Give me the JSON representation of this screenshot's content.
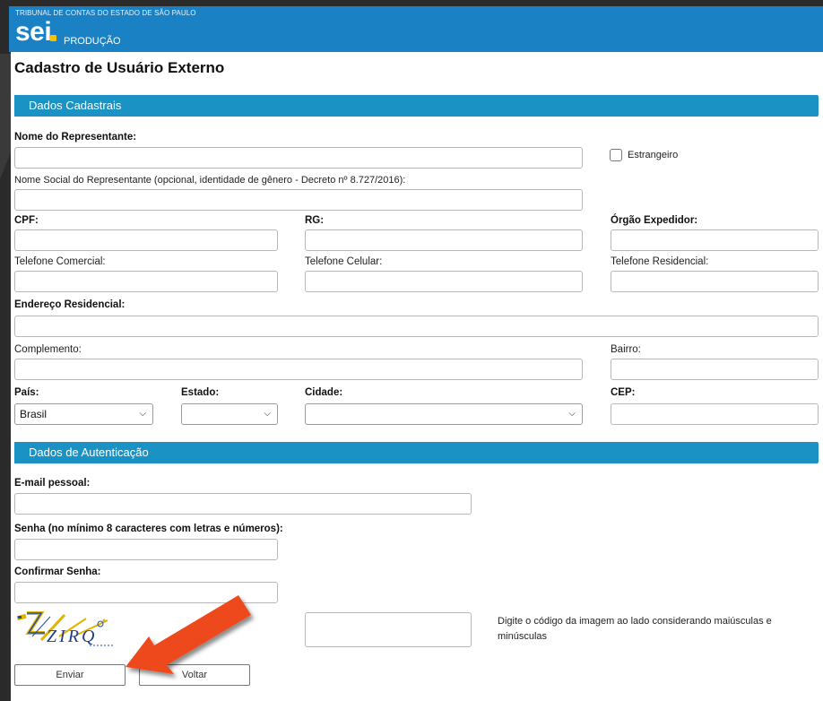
{
  "header": {
    "org": "TRIBUNAL DE CONTAS DO ESTADO DE SÃO PAULO",
    "logo": "sei",
    "environment": "PRODUÇÃO"
  },
  "page_title": "Cadastro de Usuário Externo",
  "sections": {
    "cadastrais": "Dados Cadastrais",
    "autenticacao": "Dados de Autenticação"
  },
  "fields": {
    "nome_representante": "Nome do Representante:",
    "estrangeiro": "Estrangeiro",
    "nome_social": "Nome Social do Representante (opcional, identidade de gênero - Decreto nº 8.727/2016):",
    "cpf": "CPF:",
    "rg": "RG:",
    "orgao_expedidor": "Órgão Expedidor:",
    "tel_comercial": "Telefone Comercial:",
    "tel_celular": "Telefone Celular:",
    "tel_residencial": "Telefone Residencial:",
    "endereco": "Endereço Residencial:",
    "complemento": "Complemento:",
    "bairro": "Bairro:",
    "pais": "País:",
    "estado": "Estado:",
    "cidade": "Cidade:",
    "cep": "CEP:",
    "email": "E-mail pessoal:",
    "senha": "Senha (no mínimo 8 caracteres com letras e números):",
    "confirmar_senha": "Confirmar Senha:"
  },
  "selects": {
    "pais_value": "Brasil",
    "estado_value": "",
    "cidade_value": ""
  },
  "captcha": {
    "code": "ZIRQ",
    "hint": "Digite o código da imagem ao lado considerando maiúsculas e minúsculas"
  },
  "buttons": {
    "enviar": "Enviar",
    "voltar": "Voltar"
  },
  "colors": {
    "header": "#1a82c4",
    "section_bar": "#1a92c4",
    "arrow": "#ee4a1b"
  }
}
